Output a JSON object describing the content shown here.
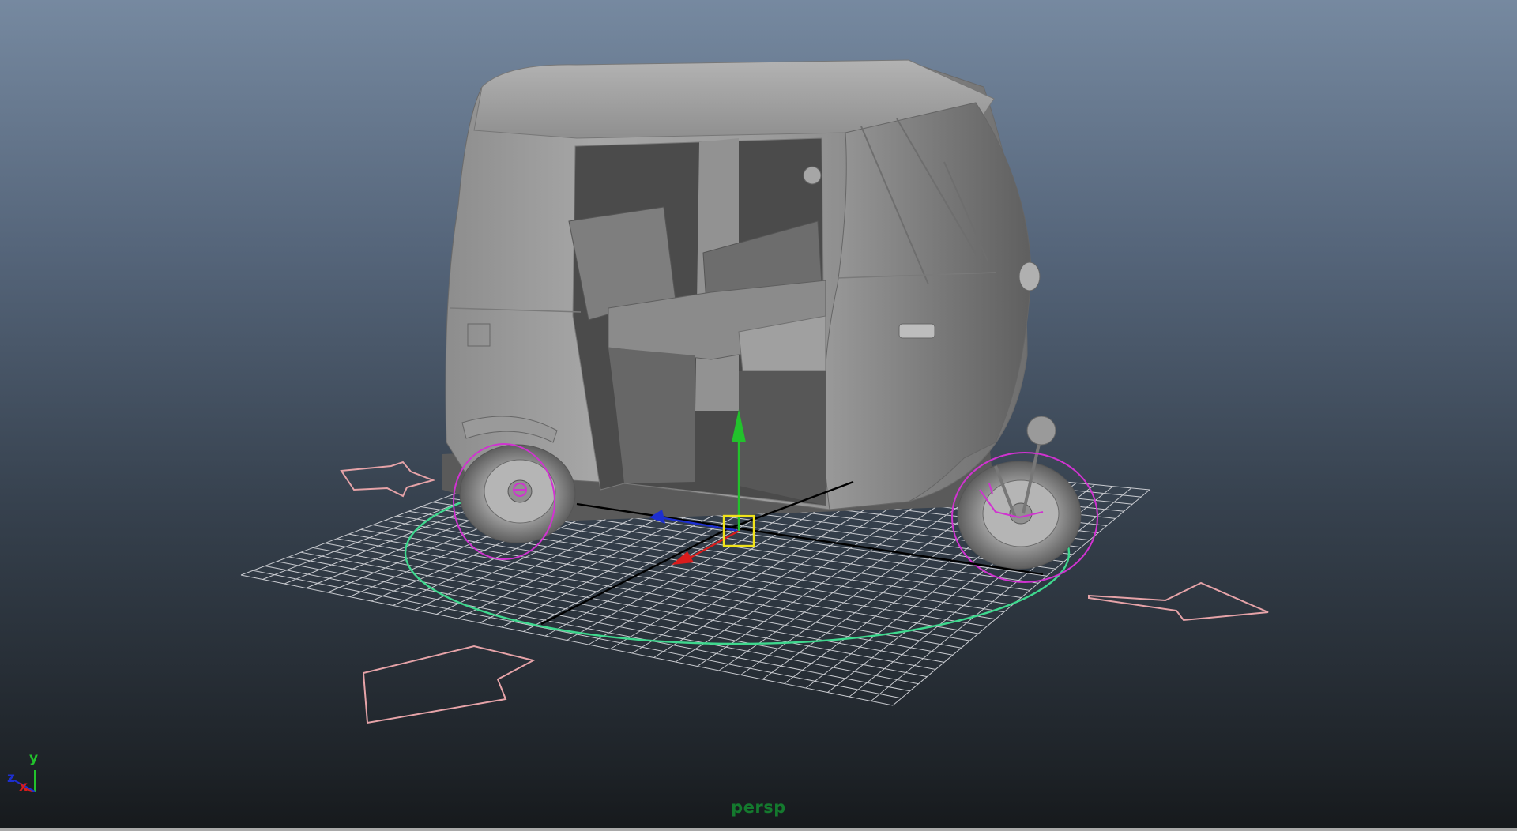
{
  "viewport": {
    "camera_name": "persp",
    "axis_indicator": {
      "y_label": "y",
      "x_label": "x",
      "z_label": "z"
    }
  },
  "colors": {
    "grid": "#c9cbd0",
    "grid_axis": "#000000",
    "arrows": "#e6a3a8",
    "ground_circle": "#3fd88e",
    "wheel_controls": "#d033d0",
    "manip_x": "#d91c1c",
    "manip_y": "#22c22c",
    "manip_z": "#1d2fd0",
    "manip_center": "#f0e21a",
    "camera_label": "#147a2e"
  }
}
